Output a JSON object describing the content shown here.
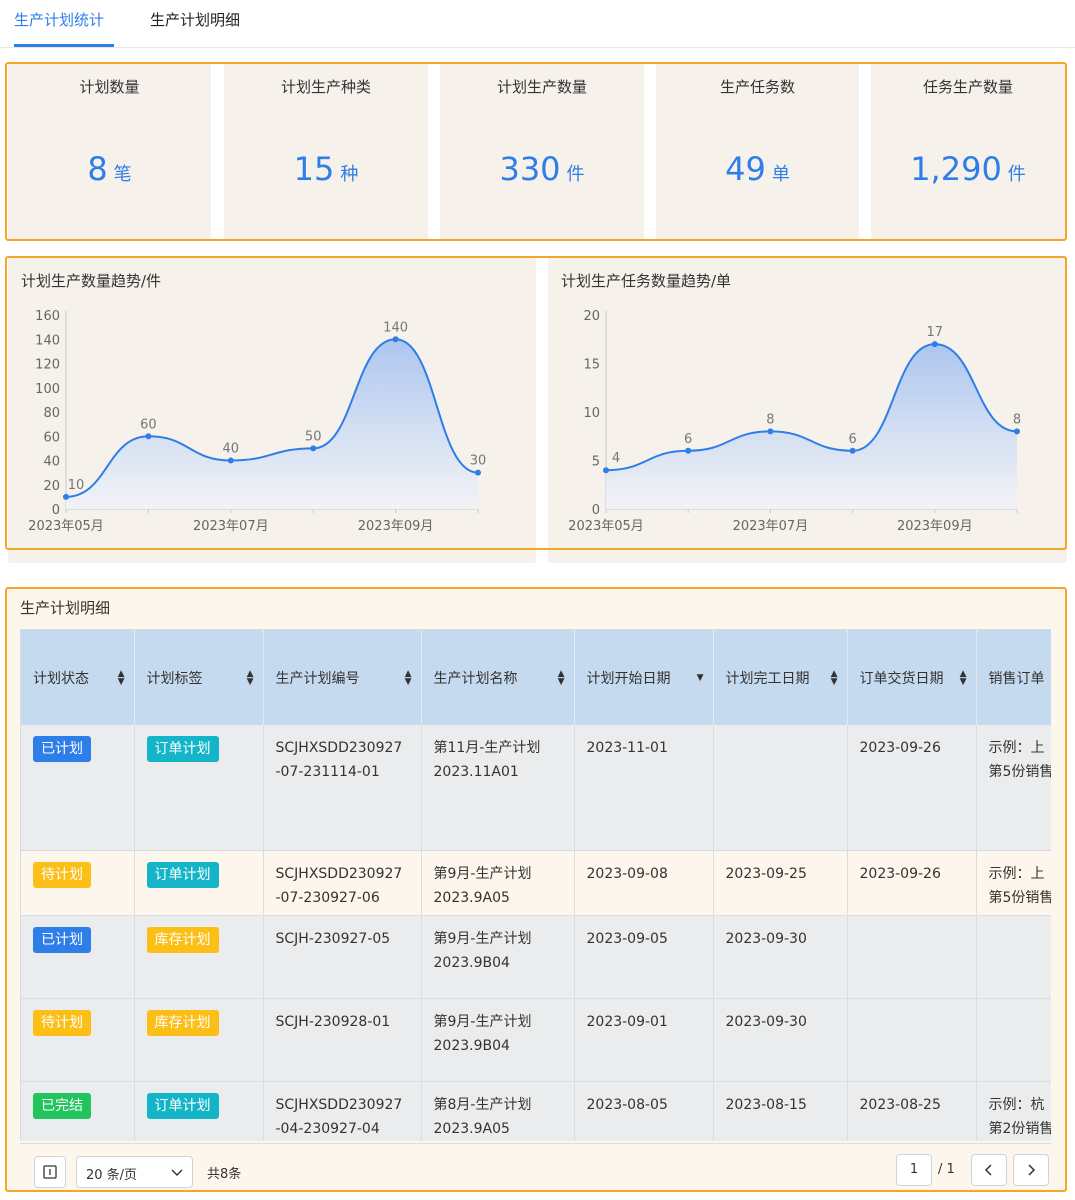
{
  "tabs": [
    {
      "label": "生产计划统计",
      "active": true
    },
    {
      "label": "生产计划明细",
      "active": false
    }
  ],
  "stats": [
    {
      "label": "计划数量",
      "value": "8",
      "unit": "笔"
    },
    {
      "label": "计划生产种类",
      "value": "15",
      "unit": "种"
    },
    {
      "label": "计划生产数量",
      "value": "330",
      "unit": "件"
    },
    {
      "label": "生产任务数",
      "value": "49",
      "unit": "单"
    },
    {
      "label": "任务生产数量",
      "value": "1,290",
      "unit": "件"
    }
  ],
  "colors": {
    "accent": "#2d7ee8",
    "frame": "#f5a623",
    "tag_blue": "#2d7ee8",
    "tag_orange": "#fbbf17",
    "tag_teal": "#14b5c8",
    "tag_green": "#21c45d"
  },
  "chart_data": [
    {
      "type": "area",
      "title": "计划生产数量趋势/件",
      "x": [
        "2023年05月",
        "2023年06月",
        "2023年07月",
        "2023年08月",
        "2023年09月",
        "2023年10月"
      ],
      "x_tick_labels": [
        "2023年05月",
        "2023年07月",
        "2023年09月"
      ],
      "values": [
        10,
        60,
        40,
        50,
        140,
        30
      ],
      "ylim": [
        0,
        160
      ],
      "yticks": [
        0,
        20,
        40,
        60,
        80,
        100,
        120,
        140,
        160
      ],
      "grid": false
    },
    {
      "type": "area",
      "title": "计划生产任务数量趋势/单",
      "x": [
        "2023年05月",
        "2023年06月",
        "2023年07月",
        "2023年08月",
        "2023年09月",
        "2023年10月"
      ],
      "x_tick_labels": [
        "2023年05月",
        "2023年07月",
        "2023年09月"
      ],
      "values": [
        4,
        6,
        8,
        6,
        17,
        8
      ],
      "ylim": [
        0,
        20
      ],
      "yticks": [
        0,
        5,
        10,
        15,
        20
      ],
      "grid": false
    }
  ],
  "table": {
    "title": "生产计划明细",
    "columns": [
      "计划状态",
      "计划标签",
      "生产计划编号",
      "生产计划名称",
      "计划开始日期",
      "计划完工日期",
      "订单交货日期",
      "销售订单"
    ],
    "rows": [
      {
        "status": "已计划",
        "status_color": "#2d7ee8",
        "tag": "订单计划",
        "tag_color": "#14b5c8",
        "code1": "SCJHXSDD230927",
        "code2": "-07-231114-01",
        "name1": "第11月-生产计划",
        "name2": "2023.11A01",
        "start": "2023-11-01",
        "end": "",
        "delivery": "2023-09-26",
        "so1": "示例：上",
        "so2": "第5份销售"
      },
      {
        "status": "待计划",
        "status_color": "#fbbf17",
        "tag": "订单计划",
        "tag_color": "#14b5c8",
        "code1": "SCJHXSDD230927",
        "code2": "-07-230927-06",
        "name1": "第9月-生产计划",
        "name2": "2023.9A05",
        "start": "2023-09-08",
        "end": "2023-09-25",
        "delivery": "2023-09-26",
        "so1": "示例：上",
        "so2": "第5份销售"
      },
      {
        "status": "已计划",
        "status_color": "#2d7ee8",
        "tag": "库存计划",
        "tag_color": "#fbbf17",
        "code1": "SCJH-230927-05",
        "code2": "",
        "name1": "第9月-生产计划",
        "name2": "2023.9B04",
        "start": "2023-09-05",
        "end": "2023-09-30",
        "delivery": "",
        "so1": "",
        "so2": ""
      },
      {
        "status": "待计划",
        "status_color": "#fbbf17",
        "tag": "库存计划",
        "tag_color": "#fbbf17",
        "code1": "SCJH-230928-01",
        "code2": "",
        "name1": "第9月-生产计划",
        "name2": "2023.9B04",
        "start": "2023-09-01",
        "end": "2023-09-30",
        "delivery": "",
        "so1": "",
        "so2": ""
      },
      {
        "status": "已完结",
        "status_color": "#21c45d",
        "tag": "订单计划",
        "tag_color": "#14b5c8",
        "code1": "SCJHXSDD230927",
        "code2": "-04-230927-04",
        "name1": "第8月-生产计划",
        "name2": "2023.9A05",
        "start": "2023-08-05",
        "end": "2023-08-15",
        "delivery": "2023-08-25",
        "so1": "示例：杭",
        "so2": "第2份销售"
      }
    ]
  },
  "pager": {
    "page_size": "20 条/页",
    "total": "共8条",
    "current_page": "1",
    "page_total": "/ 1"
  }
}
